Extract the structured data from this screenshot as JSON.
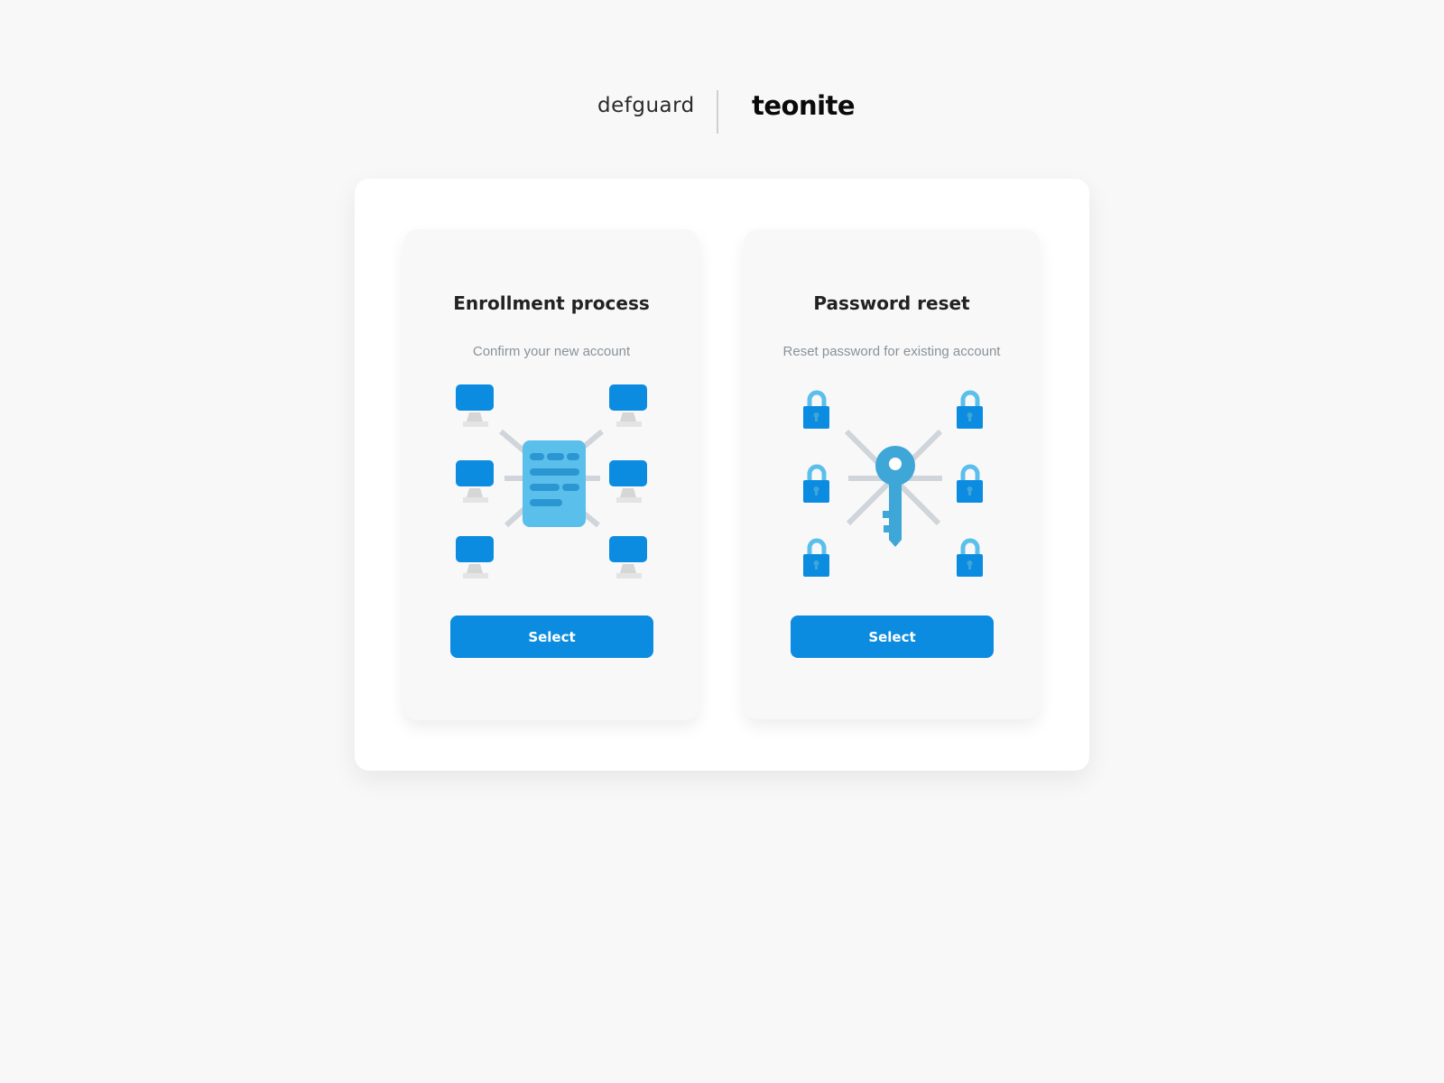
{
  "header": {
    "brand_left": "defguard",
    "brand_right": "teonite"
  },
  "cards": [
    {
      "title": "Enrollment process",
      "subtitle": "Confirm your new account",
      "illustration_icon": "server-network-illustration",
      "button_label": "Select"
    },
    {
      "title": "Password reset",
      "subtitle": "Reset password for existing account",
      "illustration_icon": "key-padlocks-illustration",
      "button_label": "Select"
    }
  ],
  "colors": {
    "page_background": "#f8f8f8",
    "panel_background": "#ffffff",
    "card_background": "#f8f8f8",
    "accent": "#0c8ce0",
    "illustration_light_blue": "#5bbfec",
    "illustration_key_blue": "#3fa6d8",
    "illustration_lines": "#cfd5da",
    "title_text": "#222222",
    "subtitle_text": "#8a9299"
  }
}
